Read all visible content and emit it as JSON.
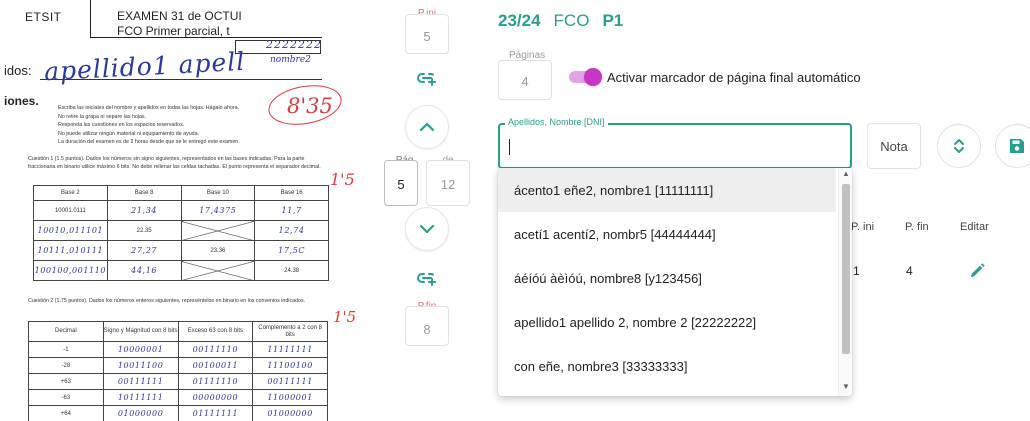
{
  "exam_sheet": {
    "institution": "ETSIT",
    "title": "EXAMEN 31 de OCTUI",
    "subtitle": "FCO Primer parcial, t",
    "handwritten_dni": "2222222",
    "handwritten_name_tag": "nombre2",
    "label_names": "idos:",
    "handwritten_name": "apellido1 apell",
    "label_instructions": "iones.",
    "grade": "8'35",
    "rules": [
      "Escriba las iniciales del nombre y apellidos en todas las hojas. Hágalo ahora.",
      "No retire la grapa ni separe las hojas.",
      "Responda las cuestiones en los espacios reservados.",
      "No puede utilizar ningún material ni equipamiento de ayuda.",
      "La duración del examen es de 2 horas desde que se le entregó este examen."
    ],
    "question1": "Cuestión 1 (1.5 puntos). Dados los números sin signo siguientes, representados en las bases indicadas. Para la parte fraccionaria en binario utilice máximo 6 bits. No debe rellenar las celdas tachadas. El punto representa el separador decimal.",
    "question1_score": "1'5",
    "table1": {
      "headers": [
        "Base 2",
        "Base 8",
        "Base 10",
        "Base 16"
      ],
      "rows": [
        [
          "10001.0111",
          "21,34",
          "17,4375",
          "11,7"
        ],
        [
          "10010,011101",
          "22.35",
          "",
          "12,74"
        ],
        [
          "10111,010111",
          "27,27",
          "23.36",
          "17,5C"
        ],
        [
          "100100,001110",
          "44,16",
          "",
          "24.38"
        ]
      ]
    },
    "question2": "Cuestión 2 (1.75 puntos). Dados los números enteros siguientes, represéntelos en binario en los convenios indicados.",
    "question2_score": "1'5",
    "table2": {
      "headers": [
        "Decimal",
        "Signo y Magnitud con 8 bits",
        "Exceso 63 con 8 bits",
        "Complemento a 2 con 8 bits"
      ],
      "rows": [
        [
          "-1",
          "10000001",
          "00111110",
          "11111111"
        ],
        [
          "-28",
          "10011100",
          "00100011",
          "11100100"
        ],
        [
          "+63",
          "00111111",
          "01111110",
          "00111111"
        ],
        [
          "-63",
          "10111111",
          "00000000",
          "11000001"
        ],
        [
          "+64",
          "01000000",
          "01111111",
          "01000000"
        ]
      ]
    }
  },
  "navigation": {
    "pini_label": "P.ini",
    "pini_value": "5",
    "pag_label": "Pág.",
    "pag_value": "5",
    "de_label": "de",
    "total_value": "12",
    "pfin_label": "P.fin",
    "pfin_value": "8"
  },
  "header": {
    "course_year": "23/24",
    "subject": "FCO",
    "part": "P1"
  },
  "pages": {
    "label": "Páginas",
    "value": "4"
  },
  "toggle": {
    "label": "Activar marcador de página final automático",
    "on": true
  },
  "search": {
    "label": "Apellidos, Nombre [DNI]",
    "value": ""
  },
  "nota": {
    "label": "Nota"
  },
  "table": {
    "headers": [
      "P. ini",
      "P. fin",
      "Editar"
    ],
    "row": [
      "1",
      "4"
    ]
  },
  "dropdown": {
    "options": [
      "ácento1 eñe2, nombre1 [11111111]",
      "acetí1 acentí2, nombr5 [44444444]",
      "áéíóú àèìóú, nombre8 [y123456]",
      "apellido1 apellido 2, nombre 2 [22222222]",
      "con eñe, nombre3 [33333333]"
    ],
    "active_index": 0
  },
  "colors": {
    "accent": "#2a9d8f",
    "toggle_on": "#c637c6",
    "ink_blue": "#2b3a9a",
    "ink_red": "#d43d3d"
  }
}
